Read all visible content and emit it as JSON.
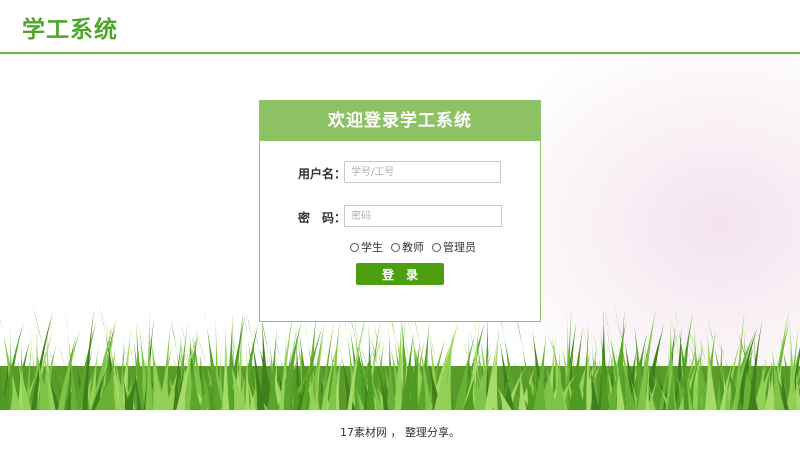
{
  "header": {
    "title": "学工系统"
  },
  "login": {
    "heading": "欢迎登录学工系统",
    "username_label": "用户名：",
    "username_placeholder": "学号/工号",
    "password_label": "密　码：",
    "password_placeholder": "密码",
    "roles": [
      "学生",
      "教师",
      "管理员"
    ],
    "submit_label": "登录"
  },
  "footer": {
    "text": "17素材网 ， 整理分享。"
  },
  "colors": {
    "brand_green": "#4ea72a",
    "header_bar": "#8cc264",
    "button": "#4e9e12"
  }
}
